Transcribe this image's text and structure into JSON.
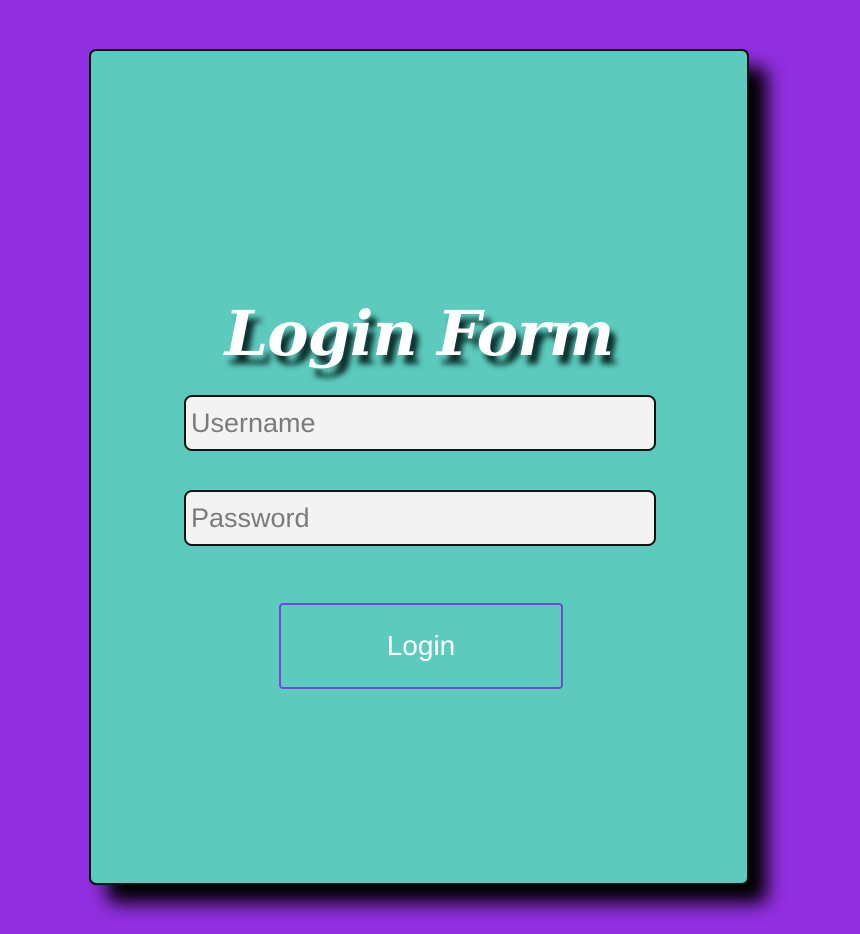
{
  "page": {
    "background_color": "#922fe0"
  },
  "form": {
    "card_color": "#5ccabd",
    "title": "Login Form",
    "username": {
      "value": "",
      "placeholder": "Username"
    },
    "password": {
      "value": "",
      "placeholder": "Password"
    },
    "login_button": {
      "label": "Login",
      "border_color": "#7148db"
    }
  }
}
